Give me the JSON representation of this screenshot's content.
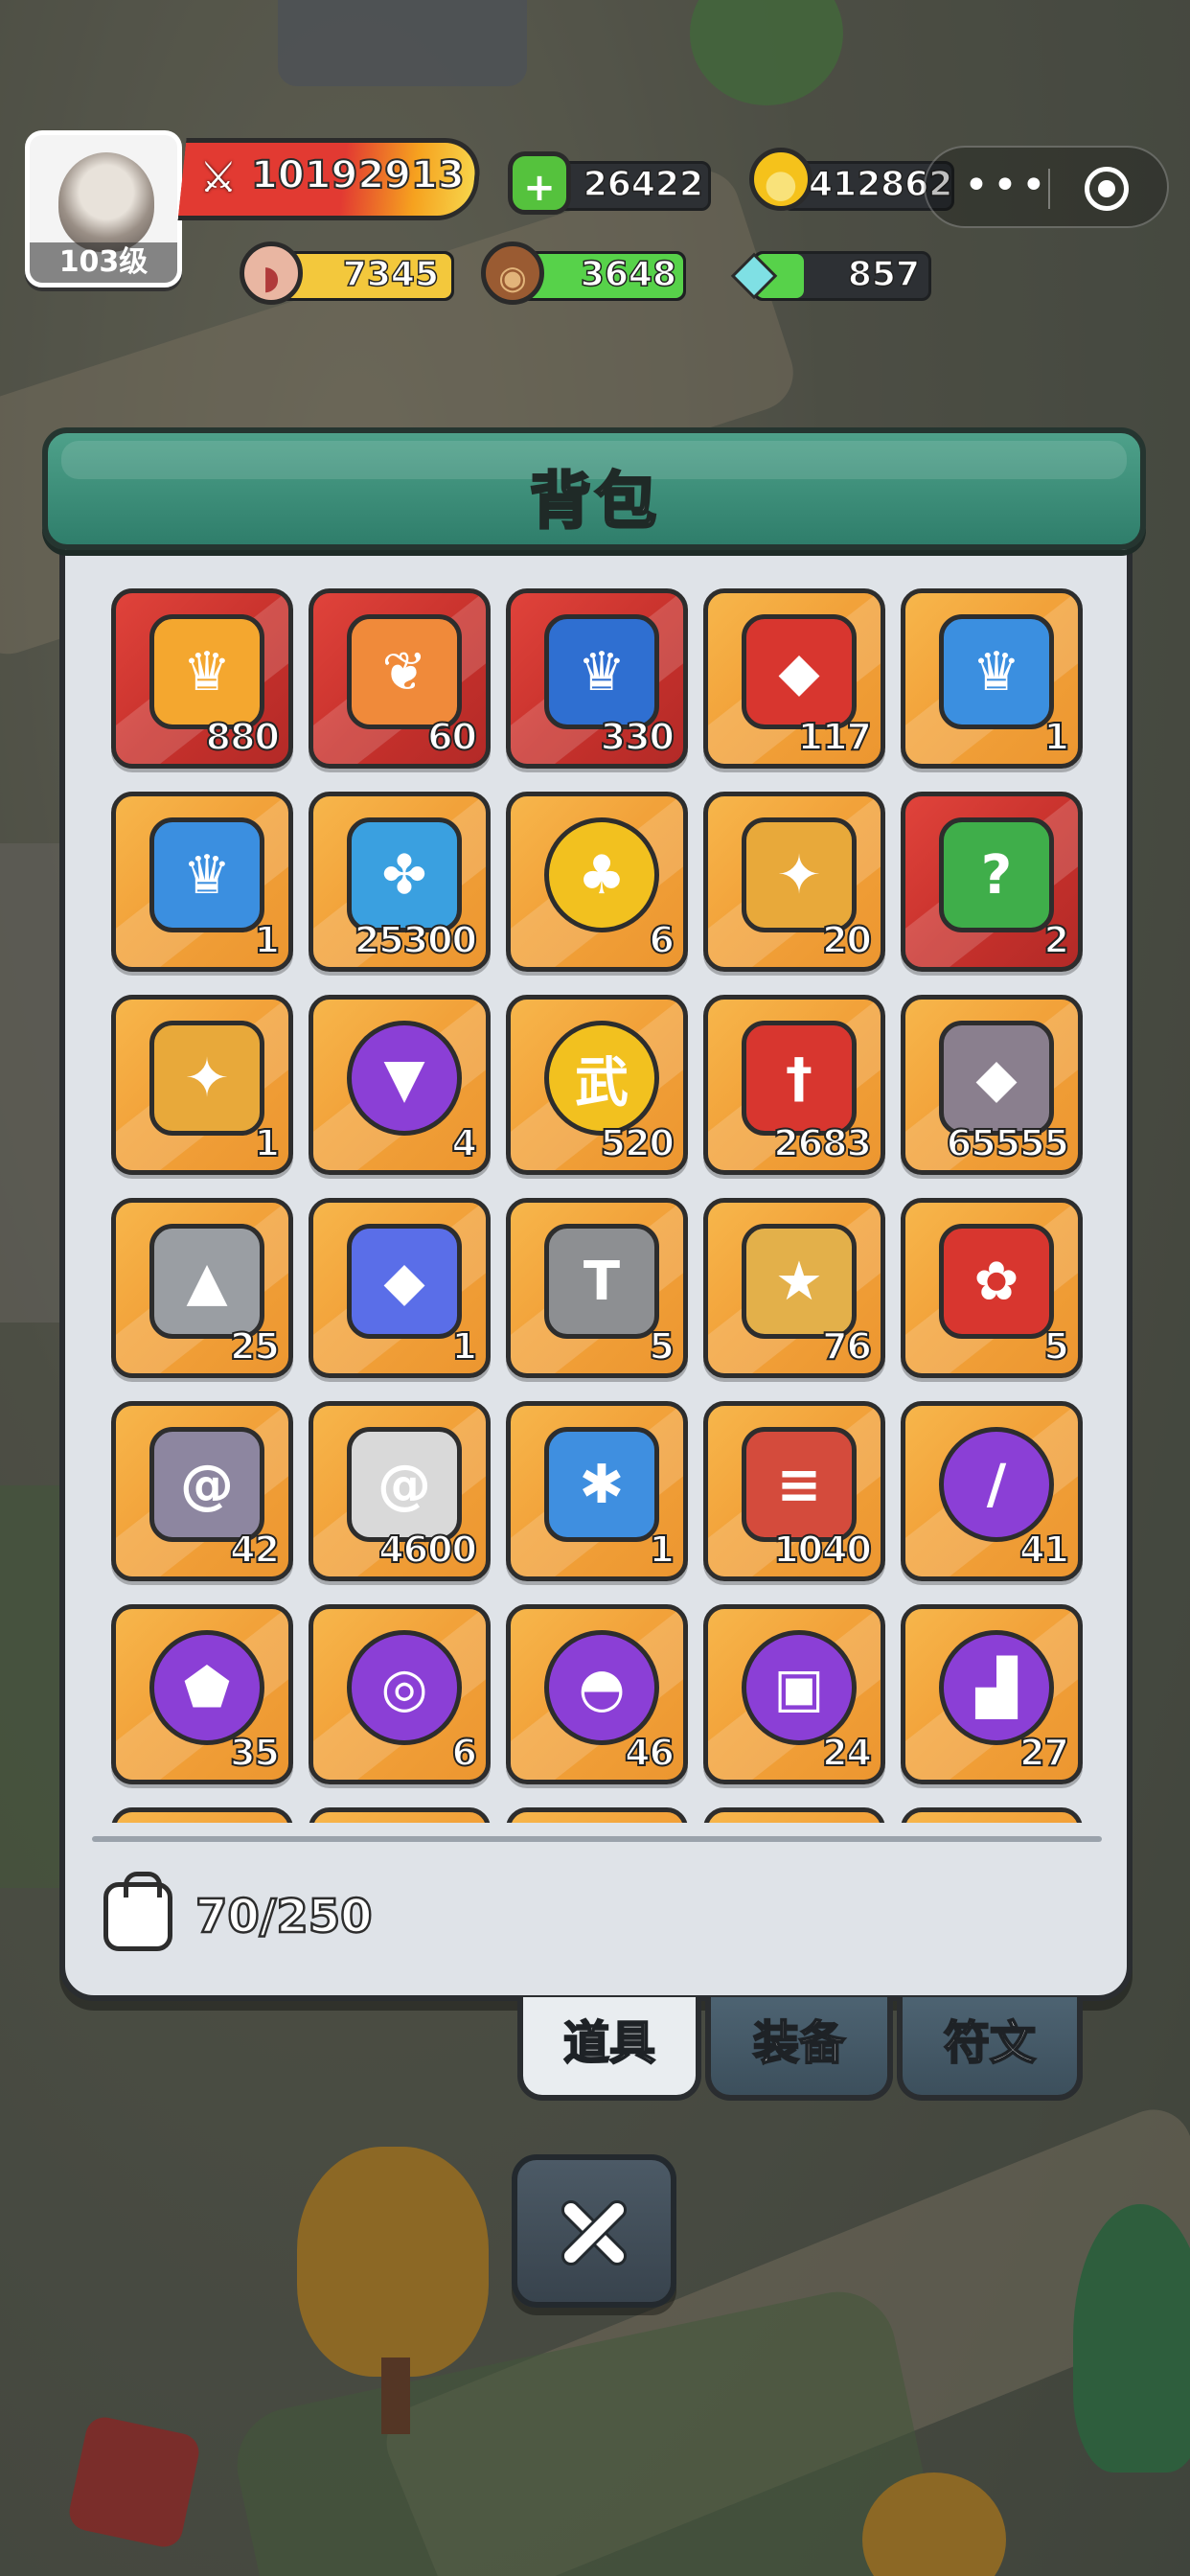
{
  "player": {
    "level_label": "103级",
    "power": "10192913"
  },
  "resources": {
    "green": "26422",
    "gold": "412862",
    "meat": "7345",
    "wood": "3648",
    "crystal": "857"
  },
  "bag": {
    "title": "背包",
    "capacity": "70/250",
    "items": [
      {
        "icon": "red-card-icon",
        "count": "880",
        "bg": "red"
      },
      {
        "icon": "cloud-card-icon",
        "count": "60",
        "bg": "red"
      },
      {
        "icon": "crown-chest-icon",
        "count": "330",
        "bg": "red"
      },
      {
        "icon": "gem-chest-icon",
        "count": "117",
        "bg": "gold"
      },
      {
        "icon": "blue-crown-chest-icon",
        "count": "1",
        "bg": "gold"
      },
      {
        "icon": "blue-crown-chest-icon",
        "count": "1",
        "bg": "gold"
      },
      {
        "icon": "pinwheel-icon",
        "count": "25300",
        "bg": "gold"
      },
      {
        "icon": "clover-coin-icon",
        "count": "6",
        "bg": "gold"
      },
      {
        "icon": "golden-chest-icon",
        "count": "20",
        "bg": "gold"
      },
      {
        "icon": "mystery-box-icon",
        "count": "2",
        "bg": "red"
      },
      {
        "icon": "golden-chest-icon",
        "count": "1",
        "bg": "gold"
      },
      {
        "icon": "shirt-coin-icon",
        "count": "4",
        "bg": "gold"
      },
      {
        "icon": "wu-coin-icon",
        "count": "520",
        "bg": "gold"
      },
      {
        "icon": "sword-badge-icon",
        "count": "2683",
        "bg": "gold"
      },
      {
        "icon": "pink-ore-icon",
        "count": "65555",
        "bg": "gold"
      },
      {
        "icon": "stone-icon",
        "count": "25",
        "bg": "gold"
      },
      {
        "icon": "blue-crystal-icon",
        "count": "1",
        "bg": "gold"
      },
      {
        "icon": "hammer-icon",
        "count": "5",
        "bg": "gold"
      },
      {
        "icon": "star-medal-icon",
        "count": "76",
        "bg": "gold"
      },
      {
        "icon": "red-ticket-icon",
        "count": "5",
        "bg": "gold"
      },
      {
        "icon": "purple-rune-stone-icon",
        "count": "42",
        "bg": "gold"
      },
      {
        "icon": "white-rune-stone-icon",
        "count": "4600",
        "bg": "gold"
      },
      {
        "icon": "blue-ticket-icon",
        "count": "1",
        "bg": "gold"
      },
      {
        "icon": "meat-chunk-icon",
        "count": "1040",
        "bg": "gold"
      },
      {
        "icon": "sword-orb-icon",
        "count": "41",
        "bg": "gold"
      },
      {
        "icon": "shield-orb-icon",
        "count": "35",
        "bg": "gold"
      },
      {
        "icon": "ring-orb-icon",
        "count": "6",
        "bg": "gold"
      },
      {
        "icon": "helmet-orb-icon",
        "count": "46",
        "bg": "gold"
      },
      {
        "icon": "armor-orb-icon",
        "count": "24",
        "bg": "gold"
      },
      {
        "icon": "boots-orb-icon",
        "count": "27",
        "bg": "gold"
      }
    ]
  },
  "tabs": {
    "items": "道具",
    "equipment": "装备",
    "runes": "符文"
  },
  "colors": {
    "header": "#3b8f79",
    "slot_gold": "#f2a23a",
    "slot_red": "#c7312c",
    "orb_purple": "#8b3fd6"
  }
}
